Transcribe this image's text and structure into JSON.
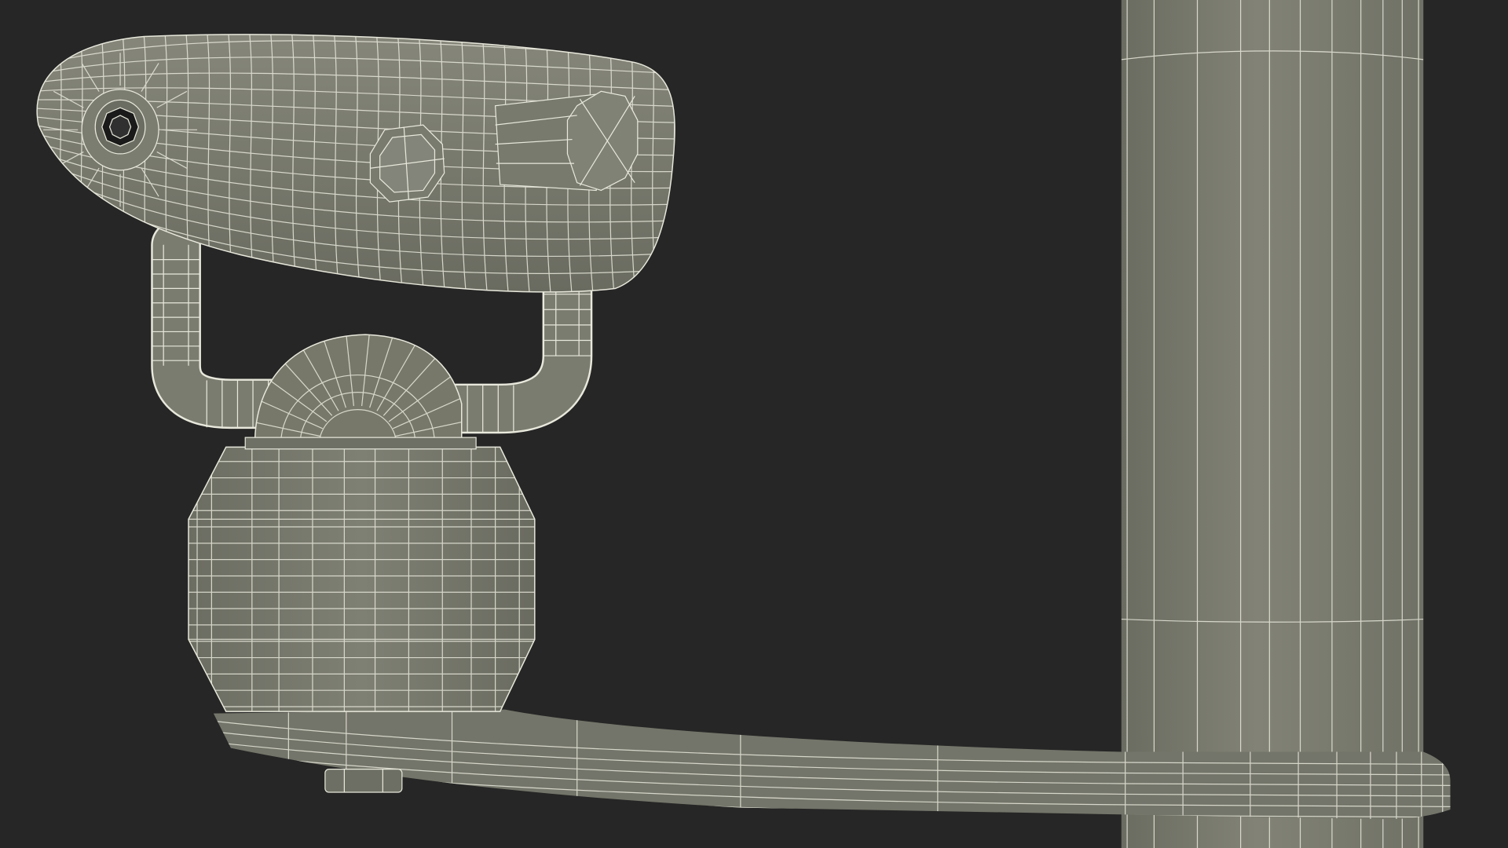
{
  "scene": {
    "background_color": "#262626",
    "model_fill": "#7d7e72",
    "model_shadow": "#5c5d53",
    "model_highlight": "#8f9083",
    "wire_color": "#e8e8dc",
    "hole_color": "#1a1a1a",
    "parts": [
      "viewer-head",
      "eyepiece",
      "knob",
      "side-hub",
      "yoke",
      "pivot-cap",
      "turret-base",
      "mounting-arm",
      "pole",
      "arm-bolt"
    ]
  }
}
